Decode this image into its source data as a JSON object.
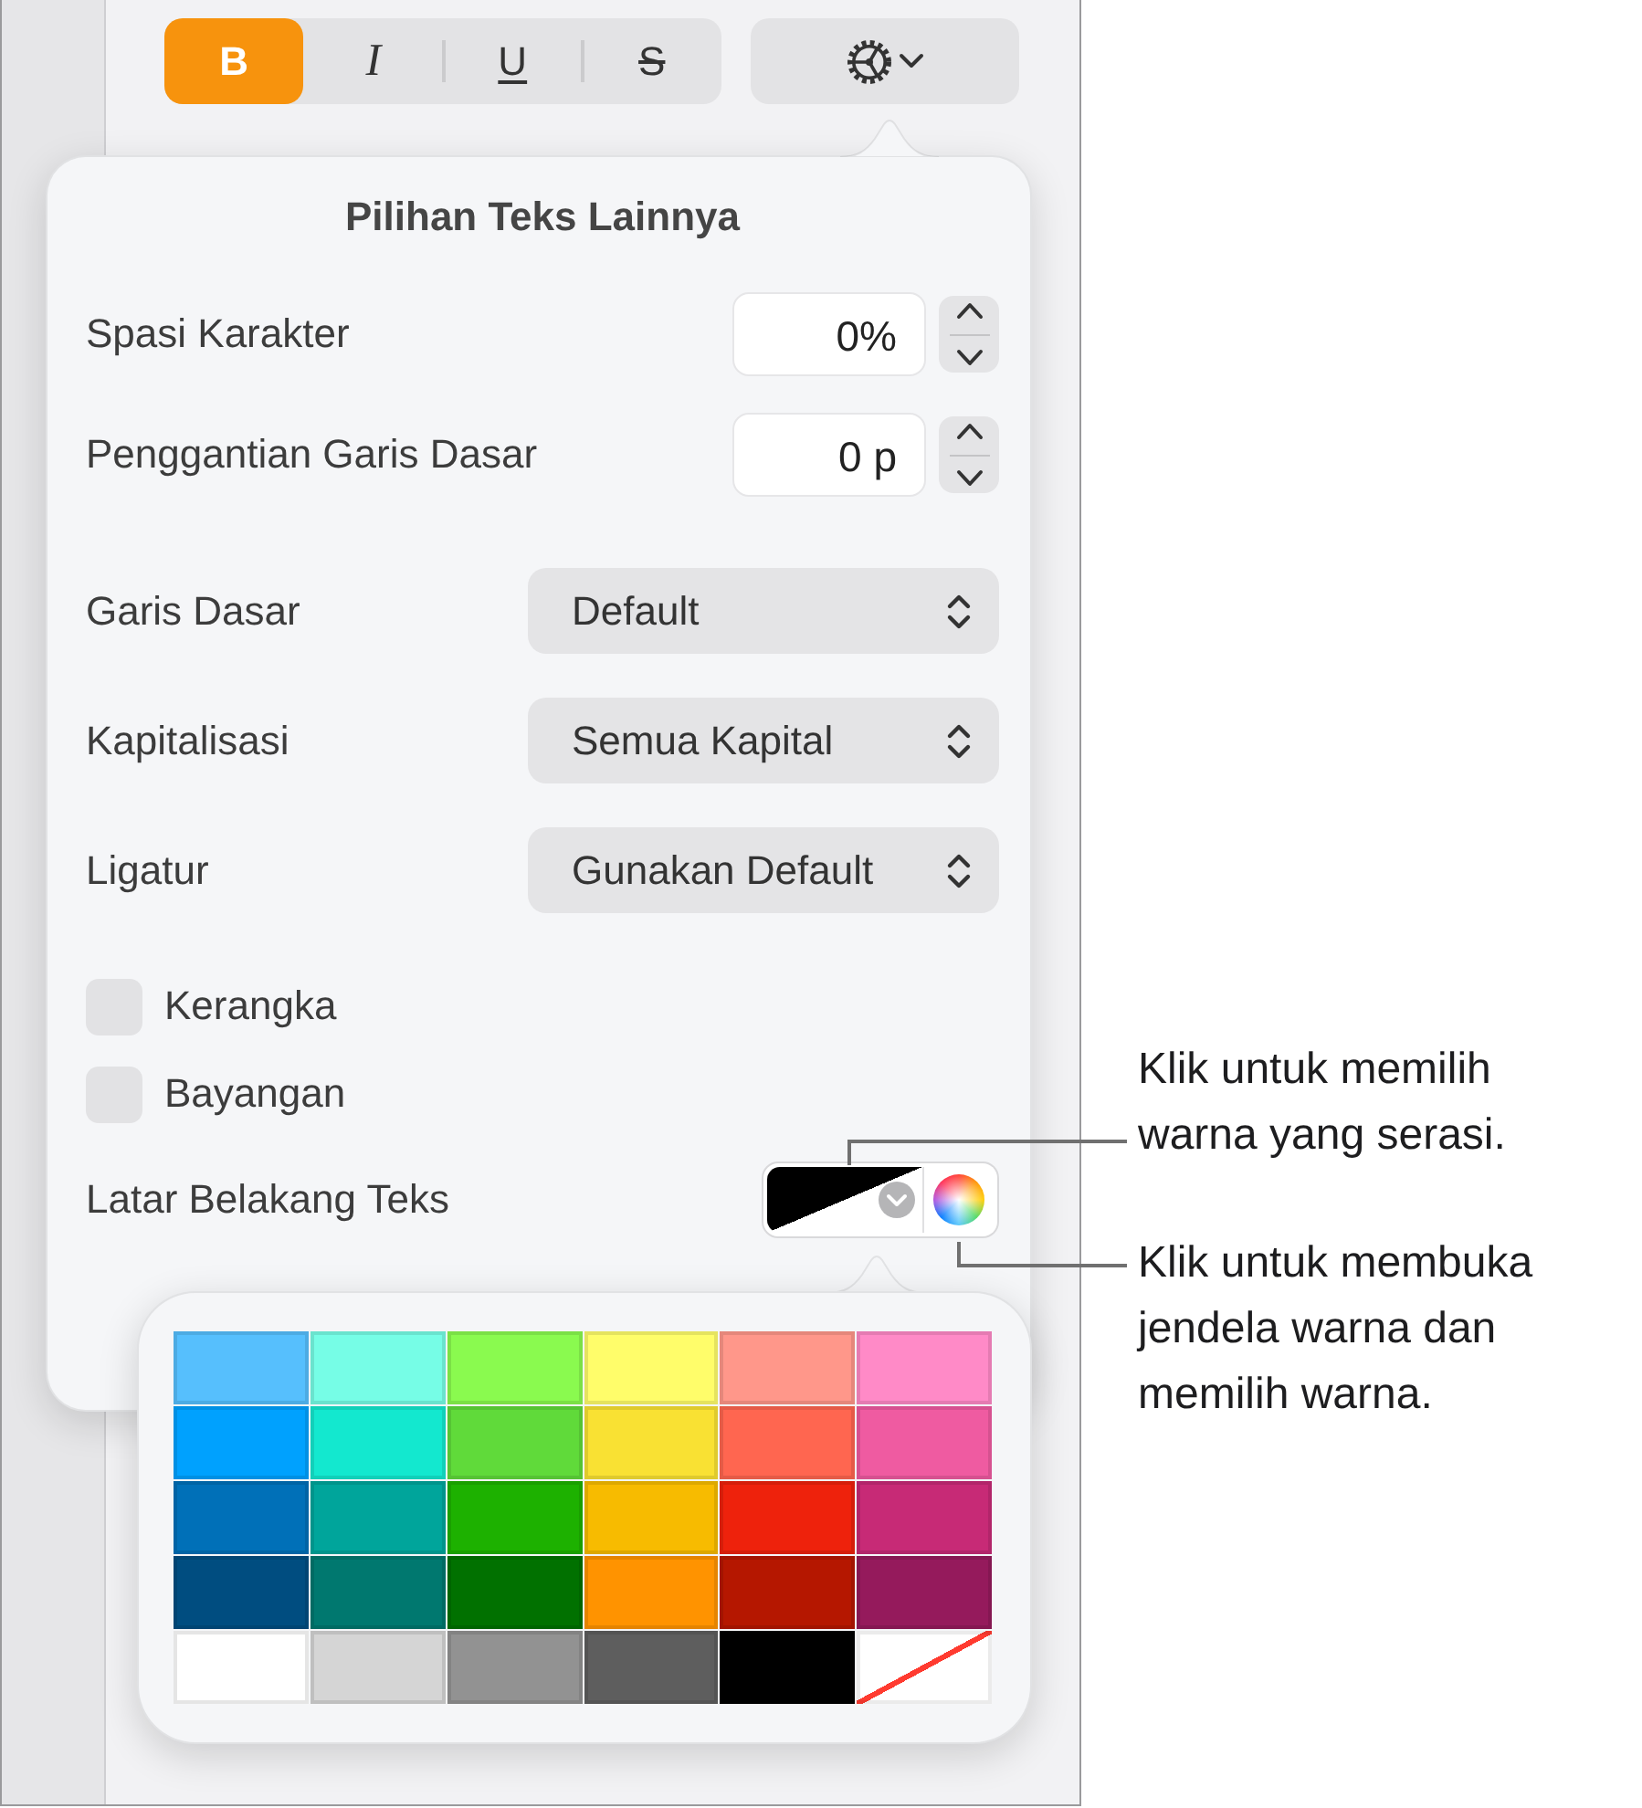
{
  "toolbar": {
    "style_buttons": [
      {
        "kind": "bold",
        "label": "B",
        "selected": true
      },
      {
        "kind": "italic",
        "label": "I",
        "selected": false
      },
      {
        "kind": "underline",
        "label": "U",
        "selected": false
      },
      {
        "kind": "strikethrough",
        "label": "S",
        "selected": false
      }
    ]
  },
  "popover": {
    "title": "Pilihan Teks Lainnya",
    "rows": [
      {
        "kind": "stepper",
        "label": "Spasi Karakter",
        "value": "0%"
      },
      {
        "kind": "stepper",
        "label": "Penggantian Garis Dasar",
        "value": "0 p"
      },
      {
        "kind": "popup",
        "label": "Garis Dasar",
        "value": "Default"
      },
      {
        "kind": "popup",
        "label": "Kapitalisasi",
        "value": "Semua Kapital"
      },
      {
        "kind": "popup",
        "label": "Ligatur",
        "value": "Gunakan Default"
      },
      {
        "kind": "checkbox",
        "label": "Kerangka",
        "checked": false
      },
      {
        "kind": "checkbox",
        "label": "Bayangan",
        "checked": false
      },
      {
        "kind": "color",
        "label": "Latar Belakang Teks"
      }
    ]
  },
  "palette": {
    "swatches": [
      {
        "kind": "color",
        "color": "#56bffd"
      },
      {
        "kind": "color",
        "color": "#76fde6"
      },
      {
        "kind": "color",
        "color": "#8afa4f"
      },
      {
        "kind": "color",
        "color": "#fffd6a"
      },
      {
        "kind": "color",
        "color": "#ff978a"
      },
      {
        "kind": "color",
        "color": "#ff8ac7"
      },
      {
        "kind": "color",
        "color": "#00a1fe"
      },
      {
        "kind": "color",
        "color": "#13e8cf"
      },
      {
        "kind": "color",
        "color": "#60da3a"
      },
      {
        "kind": "color",
        "color": "#f9e133"
      },
      {
        "kind": "color",
        "color": "#ff6650"
      },
      {
        "kind": "color",
        "color": "#ef5ba1"
      },
      {
        "kind": "color",
        "color": "#0070b8"
      },
      {
        "kind": "color",
        "color": "#00a59b"
      },
      {
        "kind": "color",
        "color": "#1db100"
      },
      {
        "kind": "color",
        "color": "#f7bb00"
      },
      {
        "kind": "color",
        "color": "#ee220c"
      },
      {
        "kind": "color",
        "color": "#c72a76"
      },
      {
        "kind": "color",
        "color": "#004d80"
      },
      {
        "kind": "color",
        "color": "#00786f"
      },
      {
        "kind": "color",
        "color": "#017100"
      },
      {
        "kind": "color",
        "color": "#ff9300"
      },
      {
        "kind": "color",
        "color": "#b51700"
      },
      {
        "kind": "color",
        "color": "#951a5c"
      },
      {
        "kind": "color",
        "color": "#ffffff"
      },
      {
        "kind": "color",
        "color": "#d5d5d5"
      },
      {
        "kind": "color",
        "color": "#929292"
      },
      {
        "kind": "color",
        "color": "#5e5e5e"
      },
      {
        "kind": "color",
        "color": "#000000"
      },
      {
        "kind": "none"
      }
    ]
  },
  "callouts": [
    "Klik untuk memilih\nwarna yang serasi.",
    "Klik untuk membuka\njendela warna dan\nmemilih warna."
  ]
}
